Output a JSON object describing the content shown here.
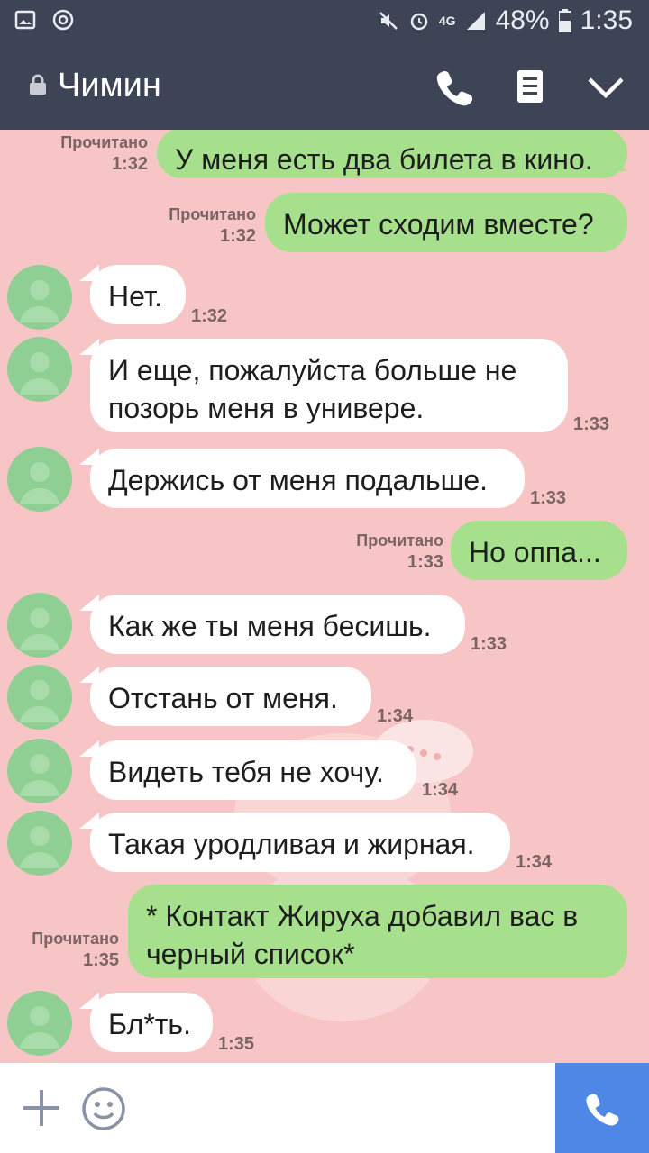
{
  "status_bar": {
    "battery": "48%",
    "time": "1:35",
    "network": "4G"
  },
  "header": {
    "contact_name": "Чимин",
    "icons": [
      "lock-icon",
      "phone-icon",
      "menu-icon",
      "chevron-down-icon"
    ]
  },
  "messages": [
    {
      "dir": "out",
      "text": "У меня есть два билета в кино.",
      "read": "Прочитано",
      "time": "1:32"
    },
    {
      "dir": "out",
      "text": "Может сходим вместе?",
      "read": "Прочитано",
      "time": "1:32"
    },
    {
      "dir": "in",
      "text": "Нет.",
      "time": "1:32"
    },
    {
      "dir": "in",
      "text": "И еще, пожалуйста больше не позорь меня в универе.",
      "time": "1:33"
    },
    {
      "dir": "in",
      "text": "Держись от меня подальше.",
      "time": "1:33"
    },
    {
      "dir": "out",
      "text": "Но оппа...",
      "read": "Прочитано",
      "time": "1:33"
    },
    {
      "dir": "in",
      "text": "Как же ты меня бесишь.",
      "time": "1:33"
    },
    {
      "dir": "in",
      "text": "Отстань от меня.",
      "time": "1:34"
    },
    {
      "dir": "in",
      "text": "Видеть тебя не хочу.",
      "time": "1:34"
    },
    {
      "dir": "in",
      "text": "Такая уродливая и жирная.",
      "time": "1:34"
    },
    {
      "dir": "out",
      "text": "* Контакт Жируха добавил вас в черный список*",
      "read": "Прочитано",
      "time": "1:35"
    },
    {
      "dir": "in",
      "text": "Бл*ть.",
      "time": "1:35"
    }
  ],
  "colors": {
    "header_bg": "#3d4455",
    "chat_bg": "#f7c5c5",
    "outgoing_bubble": "#a6e08c",
    "incoming_bubble": "#ffffff",
    "call_button": "#4e87e6"
  }
}
